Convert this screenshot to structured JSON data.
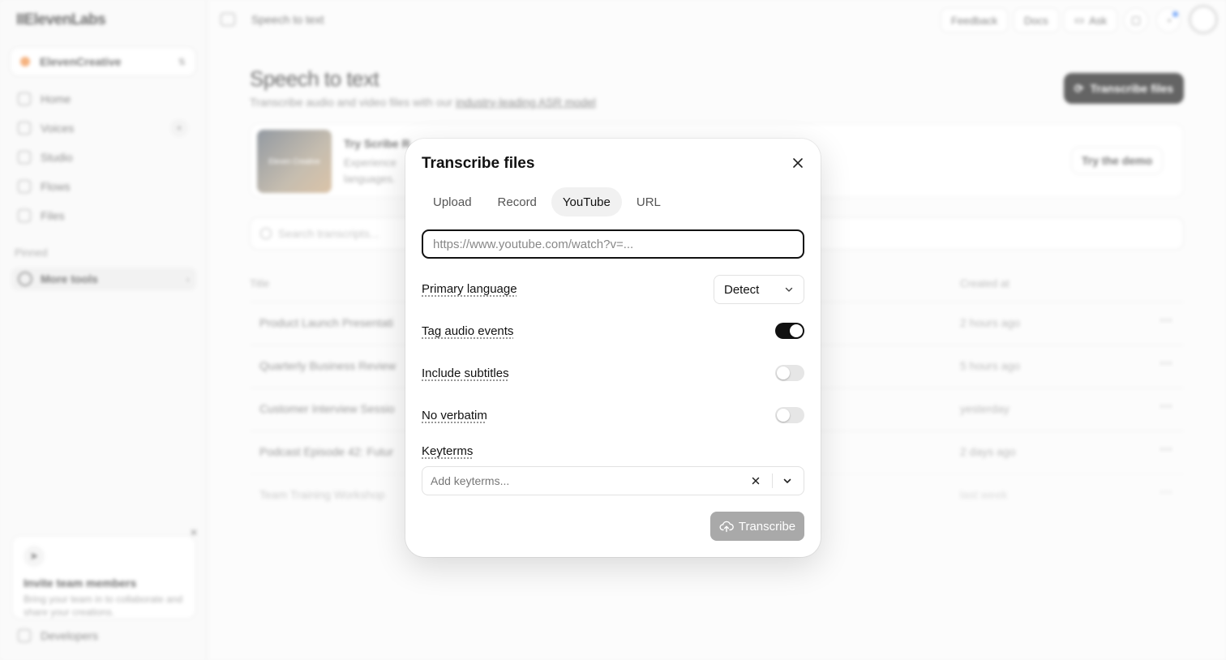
{
  "app": {
    "logo": "IIElevenLabs",
    "workspace": "ElevenCreative",
    "nav": [
      {
        "label": "Home"
      },
      {
        "label": "Voices"
      },
      {
        "label": "Studio"
      },
      {
        "label": "Flows"
      },
      {
        "label": "Files"
      }
    ],
    "pinned_label": "Pinned",
    "more_tools": "More tools",
    "invite": {
      "title": "Invite team members",
      "text": "Bring your team in to collaborate and share your creations."
    },
    "developers": "Developers"
  },
  "topbar": {
    "title": "Speech to text",
    "feedback": "Feedback",
    "docs": "Docs",
    "ask": "Ask"
  },
  "page": {
    "title": "Speech to text",
    "subtitle_prefix": "Transcribe audio and video files with our ",
    "subtitle_link": "industry-leading ASR model",
    "primary_button": "Transcribe files",
    "promo": {
      "thumb_label": "Eleven Creative",
      "title": "Try Scribe R",
      "text": "Experience languages.",
      "button": "Try the demo"
    },
    "search_placeholder": "Search transcripts...",
    "columns": {
      "title": "Title",
      "created": "Created at"
    },
    "rows": [
      {
        "title": "Product Launch Presentati",
        "created": "2 hours ago"
      },
      {
        "title": "Quarterly Business Review",
        "created": "5 hours ago"
      },
      {
        "title": "Customer Interview Sessio",
        "created": "yesterday"
      },
      {
        "title": "Podcast Episode 42: Futur",
        "created": "2 days ago"
      },
      {
        "title": "Team Training Workshop",
        "created": "last week"
      }
    ]
  },
  "modal": {
    "title": "Transcribe files",
    "tabs": [
      {
        "label": "Upload",
        "active": false
      },
      {
        "label": "Record",
        "active": false
      },
      {
        "label": "YouTube",
        "active": true
      },
      {
        "label": "URL",
        "active": false
      }
    ],
    "url_input": {
      "value": "",
      "placeholder": "https://www.youtube.com/watch?v=..."
    },
    "primary_language": {
      "label": "Primary language",
      "value": "Detect"
    },
    "tag_audio_events": {
      "label": "Tag audio events",
      "on": true
    },
    "include_subtitles": {
      "label": "Include subtitles",
      "on": false
    },
    "no_verbatim": {
      "label": "No verbatim",
      "on": false
    },
    "keyterms": {
      "label": "Keyterms",
      "placeholder": "Add keyterms..."
    },
    "submit_label": "Transcribe",
    "colors": {
      "toggle_on": "#111111",
      "toggle_off": "#e6e6e6",
      "submit_disabled": "#a9a9a9"
    }
  }
}
